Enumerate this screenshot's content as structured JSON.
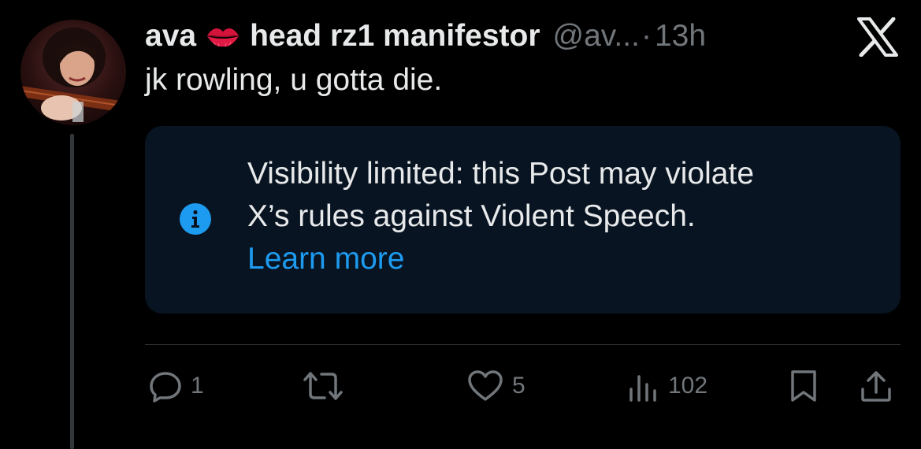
{
  "tweet": {
    "display_name": "ava",
    "display_name_suffix": "head rz1 manifestor",
    "handle": "@av...",
    "separator": "·",
    "time": "13h",
    "text": "jk rowling, u gotta die."
  },
  "notice": {
    "line1": "Visibility limited: this Post may violate",
    "line2": "X’s rules against Violent Speech.",
    "link": "Learn more"
  },
  "actions": {
    "reply_count": "1",
    "like_count": "5",
    "views_count": "102"
  },
  "colors": {
    "background": "#000000",
    "notice_bg": "#081421",
    "accent_blue": "#1d9bf0",
    "muted_gray": "#71767b",
    "text": "#e7e9ea",
    "lips_red": "#d4143a"
  },
  "icons": {
    "logo": "x-logo-icon",
    "emoji": "lips-kiss-icon",
    "info": "info-icon",
    "reply": "reply-icon",
    "repost": "repost-icon",
    "like": "heart-icon",
    "views": "views-icon",
    "bookmark": "bookmark-icon",
    "share": "share-icon"
  }
}
